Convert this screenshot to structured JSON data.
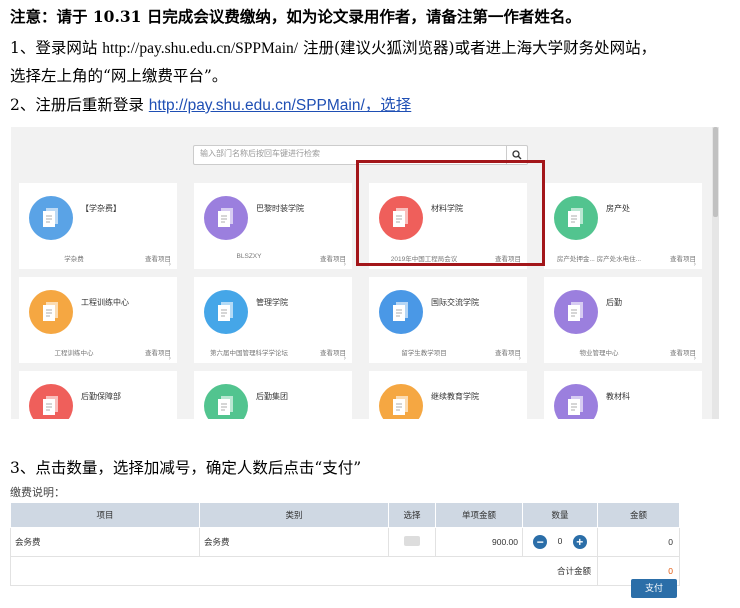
{
  "doc": {
    "notice": "注意：请于 10.31 日完成会议费缴纳，如为论文录用作者，请备注第一作者姓名。",
    "step1_prefix": "1、登录网站 ",
    "step1_url": "http://pay.shu.edu.cn/SPPMain/",
    "step1_suffix": " 注册(建议火狐浏览器)或者进上海大学财务处网站，",
    "step1_line2": "选择左上角的“网上缴费平台”。",
    "step2_prefix": "2、注册后重新登录 ",
    "step2_link": "http://pay.shu.edu.cn/SPPMain/，选择",
    "step3": "3、点击数量，选择加减号，确定人数后点击“支付”"
  },
  "portal": {
    "search_placeholder": "输入部门名称后按回车键进行检索",
    "cards": [
      {
        "title": "【学杂费】",
        "left": "学杂费",
        "right": "查看项目",
        "color": "#5aa3e6"
      },
      {
        "title": "巴黎时装学院",
        "left": "BLSZXY",
        "right": "查看项目",
        "color": "#9b7fde"
      },
      {
        "title": "材料学院",
        "left": "2019年中国工程局会议",
        "right": "查看项目",
        "color": "#ef5f5b"
      },
      {
        "title": "房产处",
        "left": "房产处押金...   房产处水电住...",
        "right": "查看项目",
        "color": "#52c48f"
      },
      {
        "title": "工程训练中心",
        "left": "工程训练中心",
        "right": "查看项目",
        "color": "#f5a742"
      },
      {
        "title": "管理学院",
        "left": "第六届中国管理科学学论坛",
        "right": "查看项目",
        "color": "#45a6e8"
      },
      {
        "title": "国际交流学院",
        "left": "留学生教学项目",
        "right": "查看项目",
        "color": "#4a98e6"
      },
      {
        "title": "后勤",
        "left": "物业管理中心",
        "right": "查看项目",
        "color": "#9b7fde"
      },
      {
        "title": "后勤保障部",
        "left": "",
        "right": "",
        "color": "#ef5f5b"
      },
      {
        "title": "后勤集团",
        "left": "",
        "right": "",
        "color": "#52c48f"
      },
      {
        "title": "继续教育学院",
        "left": "",
        "right": "",
        "color": "#f5a742"
      },
      {
        "title": "教材科",
        "left": "",
        "right": "",
        "color": "#9b7fde"
      }
    ]
  },
  "payment": {
    "heading": "缴费说明：",
    "columns": [
      "项目",
      "类别",
      "选择",
      "单项金额",
      "数量",
      "金额"
    ],
    "row": {
      "item": "会务费",
      "category": "会务费",
      "price": "900.00",
      "qty": "0",
      "amount": "0"
    },
    "total_label": "合计金额",
    "total_value": "0",
    "pay_label": "支付"
  }
}
